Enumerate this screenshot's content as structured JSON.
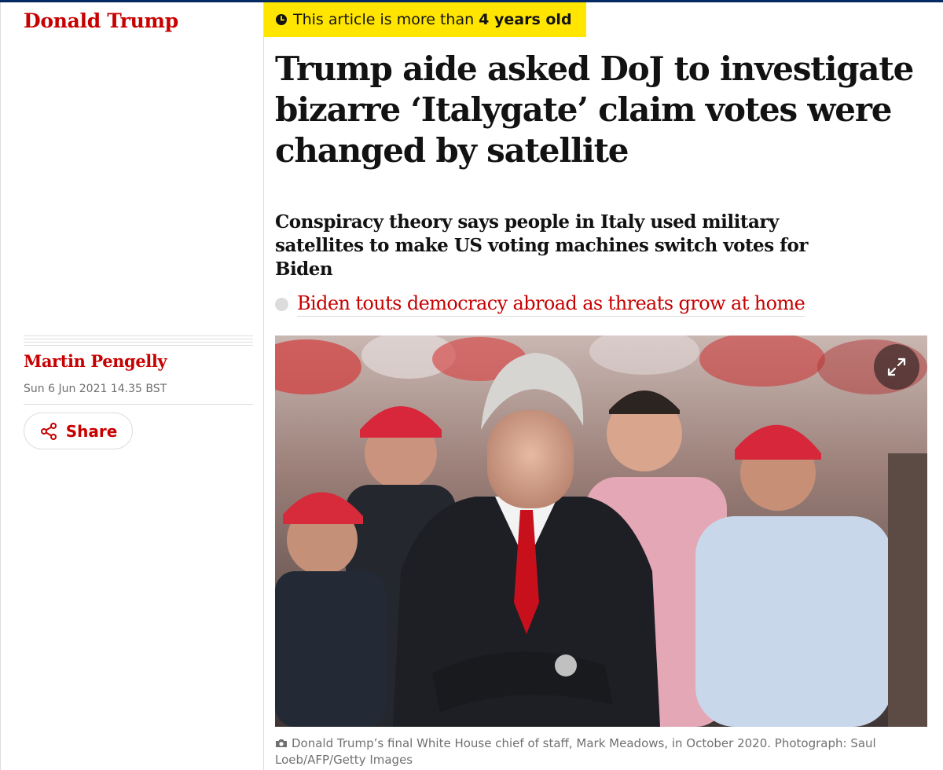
{
  "section": {
    "label": "Donald Trump"
  },
  "age_warning": {
    "prefix": "This article is more than",
    "age": "4 years old"
  },
  "article": {
    "headline": "Trump aide asked DoJ to investigate bizarre ‘Italygate’ claim votes were changed by satellite",
    "standfirst": "Conspiracy theory says people in Italy used military satellites to make US voting machines switch votes for Biden",
    "related_link": "Biden touts democracy abroad as threats grow at home"
  },
  "meta": {
    "byline": "Martin Pengelly",
    "date": "Sun 6 Jun 2021 14.35 BST",
    "share_label": "Share"
  },
  "media": {
    "image_alt": "Donald Trump’s final White House chief of staff, Mark Meadows, in October 2020",
    "caption": "Donald Trump’s final White House chief of staff, Mark Meadows, in October 2020. Photograph: Saul Loeb/AFP/Getty Images"
  },
  "icons": {
    "clock": "clock-icon",
    "share": "share-icon",
    "expand": "expand-icon",
    "camera": "camera-icon"
  },
  "colors": {
    "accent_red": "#c70000",
    "highlight_yellow": "#ffe500",
    "brand_navy": "#052962",
    "meta_grey": "#707070",
    "rule_grey": "#dcdcdc"
  }
}
